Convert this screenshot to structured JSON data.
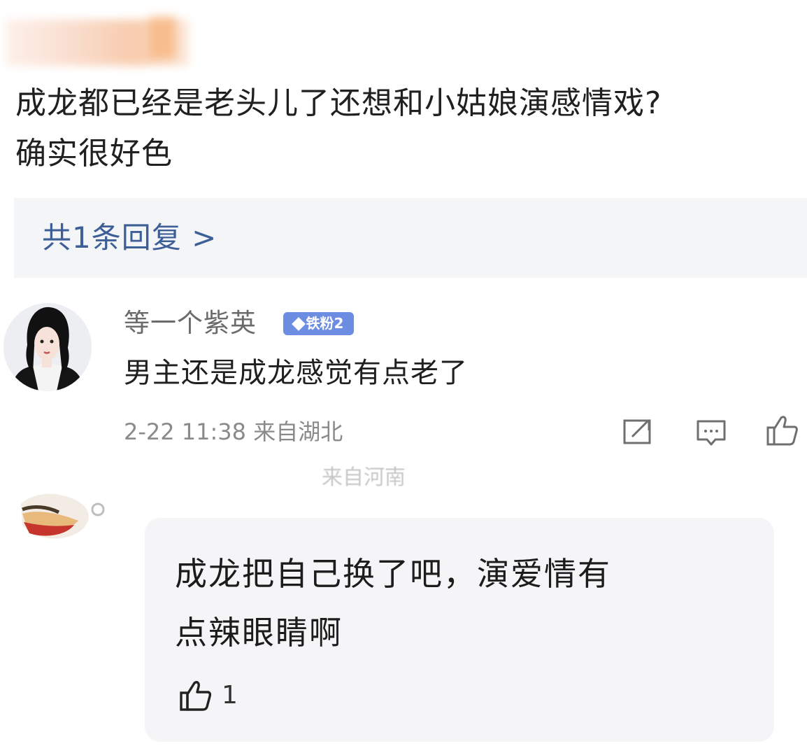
{
  "post": {
    "comment_line1": "成龙都已经是老头儿了还想和小姑娘演感情戏?",
    "comment_line2": "确实很好色",
    "replies_link": "共1条回复 >"
  },
  "reply1": {
    "username": "等一个紫英",
    "badge": "铁粉2",
    "text": "男主还是成龙感觉有点老了",
    "timestamp": "2-22 11:38",
    "location": "来自湖北",
    "actions": [
      "share-icon",
      "comment-icon",
      "like-icon"
    ]
  },
  "reply2": {
    "partial_location": "来自河南",
    "text_line1": "成龙把自己换了吧，演爱情有",
    "text_line2": "点辣眼睛啊",
    "like_count": "1"
  },
  "colors": {
    "link": "#3d5e97",
    "badge": "#6d8de3",
    "meta": "#8a8a8a"
  }
}
